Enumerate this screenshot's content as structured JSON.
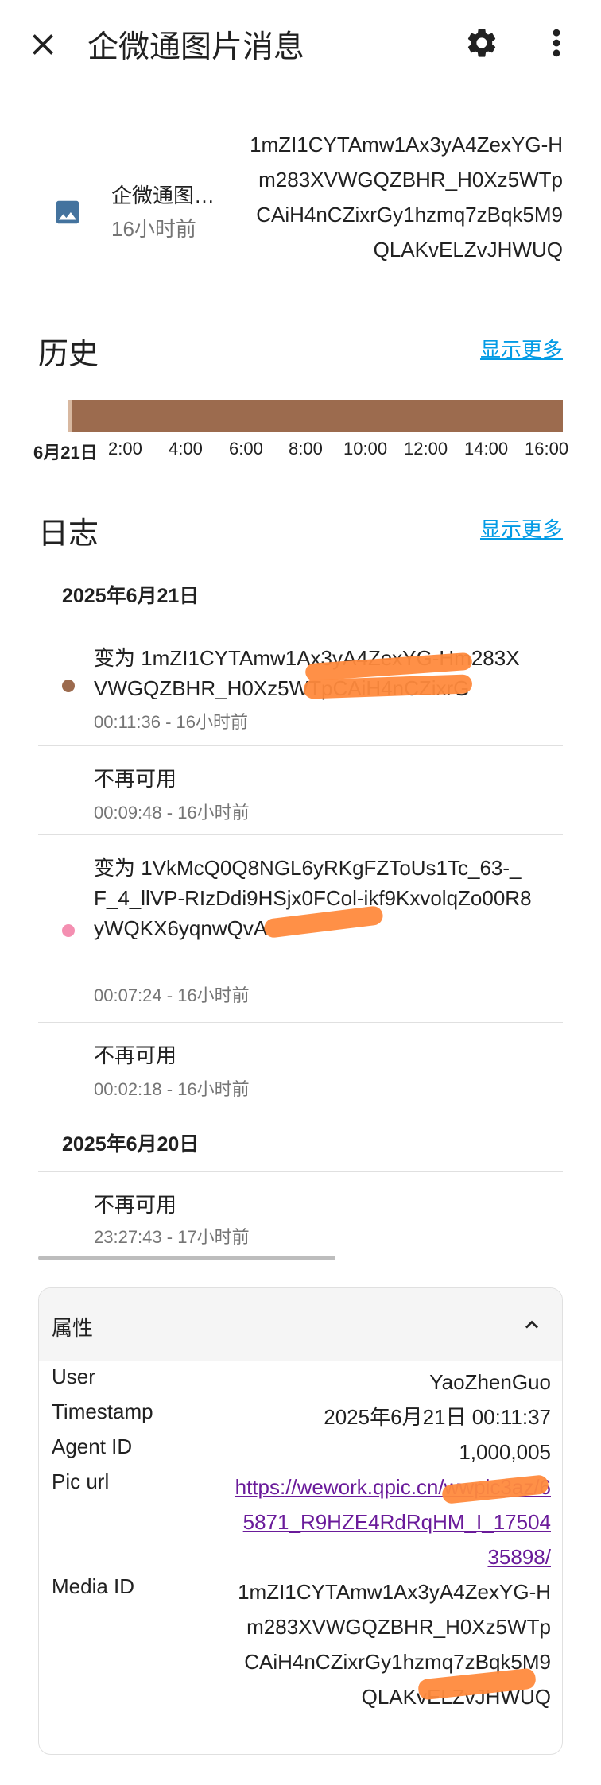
{
  "header": {
    "title": "企微通图片消息",
    "close_icon": "close-icon",
    "settings_icon": "gear-icon",
    "menu_icon": "more-vert-icon"
  },
  "entity": {
    "icon": "image-icon",
    "name": "企微通图片消息",
    "relative_time": "16小时前",
    "state": "1mZI1CYTAmw1Ax3yA4ZexYG-Hm283XVWGQZBHR_H0Xz5WTpCAiH4nCZixrGy1hzmq7zBqk5M9QLAKvELZvJHWUQ"
  },
  "history": {
    "title": "历史",
    "show_more": "显示更多",
    "bar_color": "#9c6b4e",
    "ticks": [
      "6月21日",
      "2:00",
      "4:00",
      "6:00",
      "8:00",
      "10:00",
      "12:00",
      "14:00",
      "16:00"
    ]
  },
  "logbook": {
    "title": "日志",
    "show_more": "显示更多",
    "groups": [
      {
        "date": "2025年6月21日",
        "entries": [
          {
            "message": "变为 1mZI1CYTAmw1Ax3yA4ZexYG-Hm283XVWGQZBHR_H0Xz5WTpCAiH4nCZixrG",
            "time": "00:11:36 - 16小时前",
            "dot_color": "#9c6b4e"
          },
          {
            "message": "不再可用",
            "time": "00:09:48 - 16小时前",
            "dot_color": ""
          },
          {
            "message": "变为 1VkMcQ0Q8NGL6yRKgFZToUs1Tc_63-_F_4_llVP-RIzDdi9HSjx0FCol-ikf9KxvolqZo00R8yWQKX6yqnwQvA",
            "time": "00:07:24 - 16小时前",
            "dot_color": "#f48fb1"
          },
          {
            "message": "不再可用",
            "time": "00:02:18 - 16小时前",
            "dot_color": ""
          }
        ]
      },
      {
        "date": "2025年6月20日",
        "entries": [
          {
            "message": "不再可用",
            "time": "23:27:43 - 17小时前",
            "dot_color": ""
          }
        ]
      }
    ]
  },
  "attributes": {
    "title": "属性",
    "rows": [
      {
        "key": "User",
        "value": "YaoZhenGuo"
      },
      {
        "key": "Timestamp",
        "value": "2025年6月21日 00:11:37"
      },
      {
        "key": "Agent ID",
        "value": "1,000,005"
      },
      {
        "key": "Pic url",
        "value": "https://wework.qpic.cn/wwpic3az/65871_R9HZE4RdRqHM_I_1750435898/"
      },
      {
        "key": "Media ID",
        "value": "1mZI1CYTAmw1Ax3yA4ZexYG-Hm283XVWGQZBHR_H0Xz5WTpCAiH4nCZixrGy1hzmq7zBqk5M9QLAKvELZvJHWUQ"
      }
    ]
  }
}
